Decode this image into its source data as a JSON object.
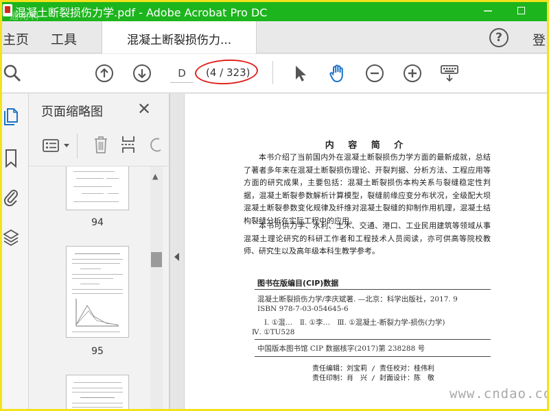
{
  "window": {
    "title": "混凝土断裂损伤力学.pdf - Adobe Acrobat Pro DC",
    "watermark": "通用科"
  },
  "tabs": {
    "home": "主页",
    "tools": "工具",
    "document": "混凝土断裂损伤力...",
    "help": "?",
    "login": "登"
  },
  "toolbar": {
    "page_input": "D",
    "page_count": "(4 / 323)",
    "highlight_color": "#e0221c",
    "icons": [
      "search-icon",
      "page-up-icon",
      "page-down-icon",
      "select-cursor-icon",
      "hand-tool-icon",
      "zoom-out-icon",
      "zoom-in-icon",
      "keyboard-icon"
    ]
  },
  "panel": {
    "title": "页面缩略图",
    "close": "✕",
    "thumbnails": [
      {
        "page": "94"
      },
      {
        "page": "95"
      }
    ]
  },
  "document": {
    "heading": "内 容 简 介",
    "paragraph1": "本书介绍了当前国内外在混凝土断裂损伤力学方面的最新成就，总结了著者多年来在混凝土断裂损伤理论、开裂判据、分析方法、工程应用等方面的研究成果，主要包括：混凝土断裂损伤本构关系与裂缝稳定性判据，混凝土断裂参数解析计算模型，裂缝前缘应变分布状况，全级配大坝混凝土断裂参数变化规律及纤维对混凝土裂缝的抑制作用机理，混凝土结构裂缝分析在实际工程中的应用。",
    "paragraph2": "本书可供力学、水利、土木、交通、港口、工业民用建筑等领域从事混凝土理论研究的科研工作者和工程技术人员阅读，亦可供高等院校教师、研究生以及高年级本科生教学参考。",
    "cip_heading": "图书在版编目(CIP)数据",
    "cip_line1": "混凝土断裂损伤力学/李庆斌著. —北京：科学出版社，2017. 9",
    "cip_line2": "ISBN 978-7-03-054645-6",
    "cip_line3": "Ⅰ. ①混…　Ⅱ. ①李…　Ⅲ. ①混凝土-断裂力学-损伤(力学)",
    "cip_line4": "Ⅳ. ①TU528",
    "cip_line5": "中国版本图书馆 CIP 数据核字(2017)第 238288 号",
    "credit1": "责任编辑：刘宝莉 / 责任校对：桂伟利",
    "credit2": "责任印制：肖　兴 / 封面设计：陈　敬",
    "site_watermark": "www.cndao.com"
  },
  "colors": {
    "titlebar": "#1db51d",
    "frame": "#f4e21c",
    "accent_blue": "#1a73c9"
  }
}
